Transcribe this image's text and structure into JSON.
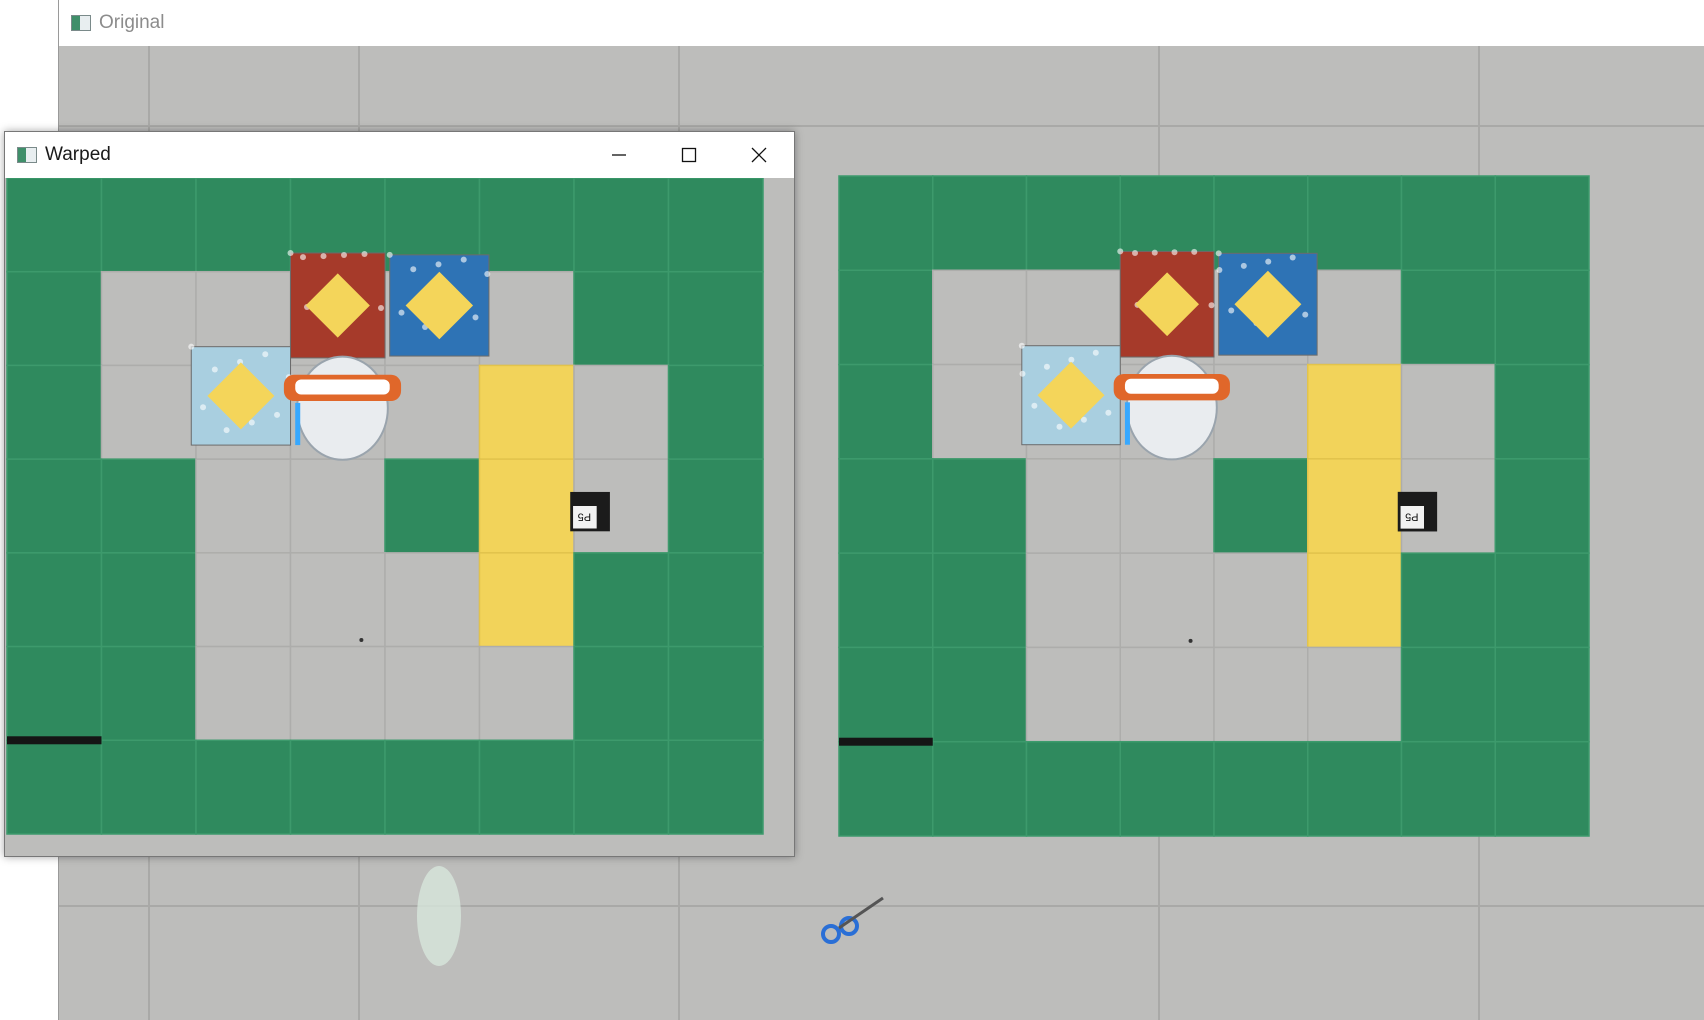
{
  "windows": {
    "original": {
      "title": "Original"
    },
    "warped": {
      "title": "Warped",
      "controls": {
        "minimize": "minimize-icon",
        "maximize": "maximize-icon",
        "close": "close-icon"
      }
    }
  },
  "scene": {
    "sign_text": "P5",
    "colors": {
      "floor": "#bdbdbb",
      "green": "#2f8a5e",
      "yellow": "#f2d35a",
      "red_box": "#a63a2a",
      "blue_box": "#2e73b5",
      "light_box": "#a9cfe0",
      "diamond": "#f4d55a"
    }
  }
}
